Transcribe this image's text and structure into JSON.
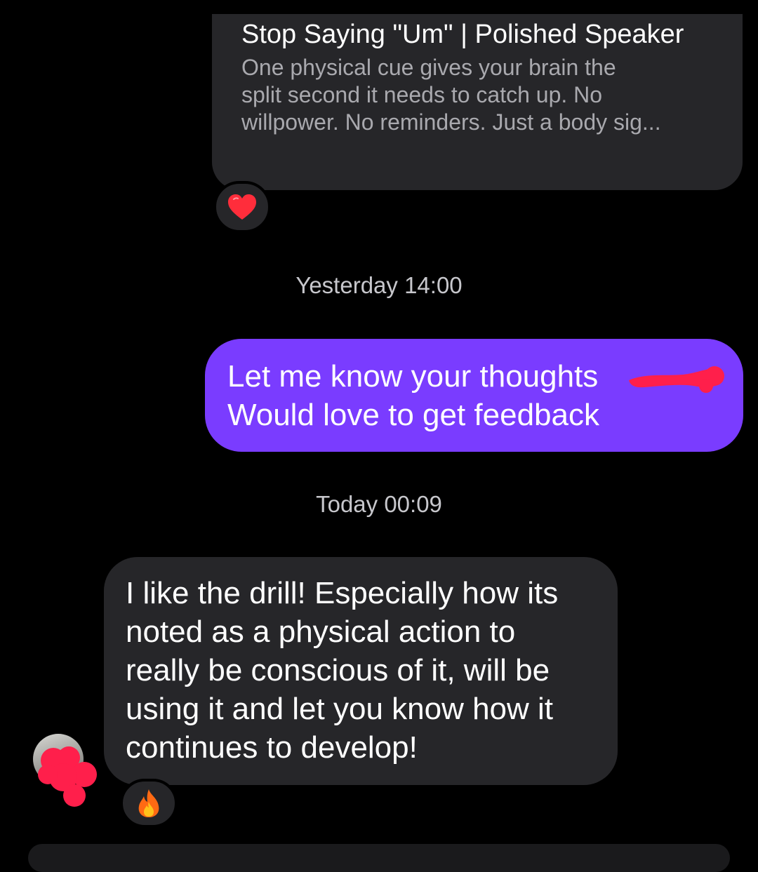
{
  "thread": {
    "link_card": {
      "title": "Stop Saying \"Um\" | Polished Speaker",
      "description": "One physical cue gives your brain the\nsplit second it needs to catch up. No\nwillpower. No reminders. Just a body sig...",
      "reaction_icon": "heart-icon"
    },
    "timestamps": [
      "Yesterday 14:00",
      "Today 00:09"
    ],
    "outgoing": {
      "lines": [
        "Let me know your thoughts",
        "Would love to get feedback"
      ],
      "color": "#7a3cff"
    },
    "incoming": {
      "lines": [
        "I like the drill! Especially how its",
        "noted as a physical action to",
        "really be conscious of it, will be",
        "using it and let you know how it",
        "continues to develop!"
      ],
      "reaction_icon": "fire-icon"
    },
    "redaction_color": "#ff1f4b"
  }
}
